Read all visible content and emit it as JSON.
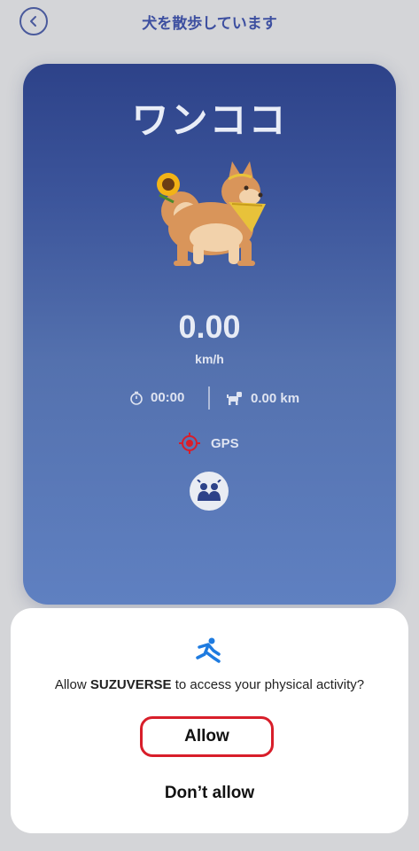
{
  "header": {
    "back_icon": "chevron-left-icon",
    "title": "犬を散歩しています"
  },
  "walk_card": {
    "dog_name": "ワンココ",
    "dog_image": "shiba-inu-with-sunflower",
    "speed": "0.00",
    "speed_unit": "km/h",
    "time": "00:00",
    "distance": "0.00 km",
    "gps_label": "GPS",
    "gps_color": "#d81e2a"
  },
  "permission_dialog": {
    "icon": "running-person-icon",
    "prompt_prefix": "Allow ",
    "app_name": "SUZUVERSE",
    "prompt_suffix": " to access your physical activity?",
    "allow_label": "Allow",
    "deny_label": "Don’t allow",
    "highlight_color": "#d81e2a"
  }
}
